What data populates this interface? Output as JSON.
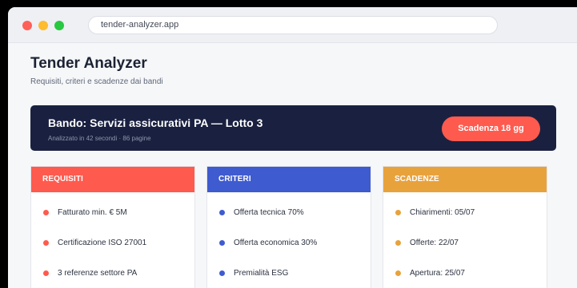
{
  "browser": {
    "url": "tender-analyzer.app"
  },
  "header": {
    "title": "Tender Analyzer",
    "subtitle": "Requisiti, criteri e scadenze dai bandi"
  },
  "banner": {
    "title": "Bando: Servizi assicurativi PA — Lotto 3",
    "meta": "Analizzato in 42 secondi · 86 pagine",
    "deadline_label": "Scadenza 18 gg"
  },
  "columns": [
    {
      "title": "REQUISITI",
      "color": "#ff5a4e",
      "items": [
        "Fatturato min. € 5M",
        "Certificazione ISO 27001",
        "3 referenze settore PA"
      ]
    },
    {
      "title": "CRITERI",
      "color": "#3f5bd0",
      "items": [
        "Offerta tecnica 70%",
        "Offerta economica 30%",
        "Premialità ESG"
      ]
    },
    {
      "title": "SCADENZE",
      "color": "#e8a23c",
      "items": [
        "Chiarimenti: 05/07",
        "Offerte: 22/07",
        "Apertura: 25/07"
      ]
    }
  ]
}
